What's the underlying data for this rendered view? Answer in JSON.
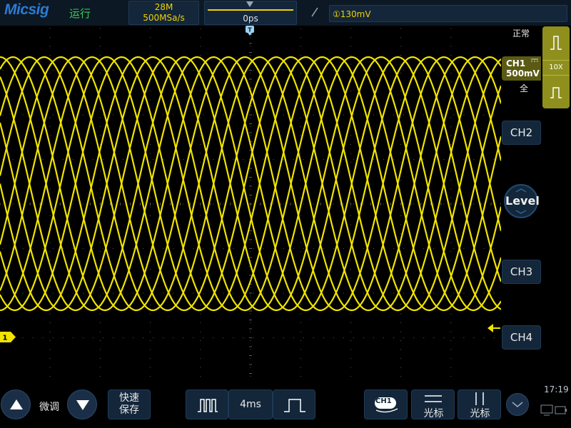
{
  "app": {
    "logo": "Micsig",
    "run_state": "运行"
  },
  "acquisition": {
    "memory_depth": "28M",
    "sample_rate": "500MSa/s"
  },
  "timebase_bar": {
    "position": "0ps",
    "view_start": 0.0,
    "view_end": 1.0
  },
  "trigger": {
    "edge": "rising",
    "level_text": "①130mV",
    "ch1_label": "1"
  },
  "right_panel": {
    "mode_label": "正常",
    "ch1": {
      "name": "CH1",
      "coupling": "DC",
      "scale": "500mV",
      "probe": "10X"
    },
    "bandwidth_label": "全",
    "channels": [
      "CH2",
      "CH3",
      "CH4"
    ],
    "level_knob": "Level"
  },
  "bottom": {
    "fine_label": "微调",
    "save_label_line1": "快速",
    "save_label_line2": "保存",
    "timebase": "4ms",
    "ch1_badge": "CH1",
    "cursor1_label": "光标",
    "cursor2_label": "光标",
    "time": "17:19"
  },
  "colors": {
    "trace": "#f0e400",
    "accent": "#2b7bd3",
    "running": "#3cc85a",
    "panel_bg": "#13263a",
    "ch1_panel": "#8f8f1e"
  },
  "icons": {
    "fine_up": "triangle-up-icon",
    "fine_down": "triangle-down-icon",
    "timebase_narrow": "narrow-pulse-icon",
    "timebase_wide": "wide-pulse-icon",
    "expand": "chevron-down-icon"
  }
}
